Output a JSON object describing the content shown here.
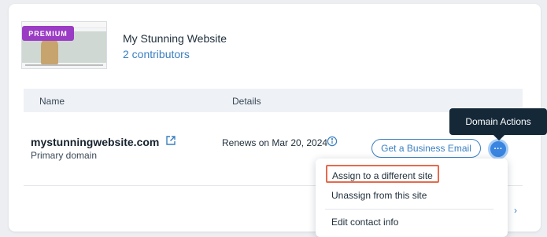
{
  "site": {
    "badge": "PREMIUM",
    "name": "My Stunning Website",
    "contributors": "2 contributors"
  },
  "table": {
    "columns": [
      "Name",
      "Details"
    ],
    "rows": [
      {
        "domain": "mystunningwebsite.com",
        "subtitle": "Primary domain",
        "details": "Renews on Mar 20, 2024",
        "action_button": "Get a Business Email",
        "more_label": "···"
      }
    ]
  },
  "tooltip": "Domain Actions",
  "menu": {
    "items": [
      "Assign to a different site",
      "Unassign from this site",
      "Edit contact info"
    ]
  },
  "colors": {
    "accent": "#3a7fc2",
    "premium": "#9b3cc5",
    "highlight": "#e46b4d",
    "tooltip_bg": "#142838"
  }
}
